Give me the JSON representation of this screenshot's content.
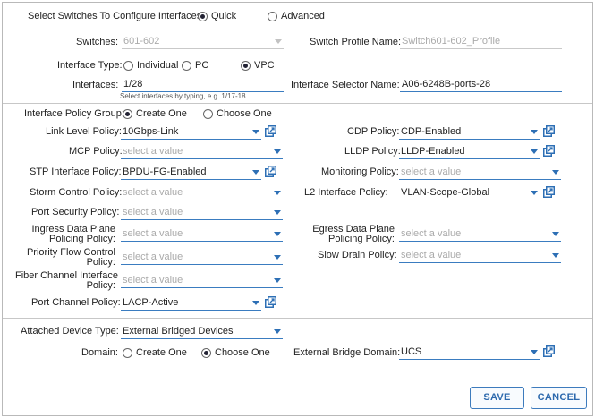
{
  "select_switches": {
    "label": "Select Switches To Configure Interfaces:",
    "options": [
      "Quick",
      "Advanced"
    ],
    "selected": "Quick"
  },
  "switches": {
    "label": "Switches:",
    "value": "601-602"
  },
  "switch_profile": {
    "label": "Switch Profile Name:",
    "value": "Switch601-602_Profile"
  },
  "interface_type": {
    "label": "Interface Type:",
    "options": [
      "Individual",
      "PC",
      "VPC"
    ],
    "selected": "VPC"
  },
  "interfaces": {
    "label": "Interfaces:",
    "value": "1/28",
    "hint": "Select interfaces by typing, e.g. 1/17-18."
  },
  "interface_selector": {
    "label": "Interface Selector Name:",
    "value": "A06-6248B-ports-28"
  },
  "policy_group": {
    "label": "Interface Policy Group:",
    "options": [
      "Create One",
      "Choose One"
    ],
    "selected": "Create One"
  },
  "placeholder": "select a value",
  "left_policies": {
    "link_level": {
      "label": "Link Level Policy:",
      "value": "10Gbps-Link"
    },
    "mcp": {
      "label": "MCP Policy:",
      "value": ""
    },
    "stp": {
      "label": "STP Interface Policy:",
      "value": "BPDU-FG-Enabled"
    },
    "storm": {
      "label": "Storm Control Policy:",
      "value": ""
    },
    "port_security": {
      "label": "Port Security Policy:",
      "value": ""
    },
    "ingress": {
      "label_1": "Ingress Data Plane",
      "label_2": "Policing Policy:",
      "value": ""
    },
    "pfc": {
      "label_1": "Priority Flow Control",
      "label_2": "Policy:",
      "value": ""
    },
    "fiber": {
      "label_1": "Fiber Channel Interface",
      "label_2": "Policy:",
      "value": ""
    },
    "port_channel": {
      "label": "Port Channel Policy:",
      "value": "LACP-Active"
    }
  },
  "right_policies": {
    "cdp": {
      "label": "CDP Policy:",
      "value": "CDP-Enabled"
    },
    "lldp": {
      "label": "LLDP Policy:",
      "value": "LLDP-Enabled"
    },
    "monitoring": {
      "label": "Monitoring Policy:",
      "value": ""
    },
    "l2": {
      "label": "L2 Interface Policy:",
      "value": "VLAN-Scope-Global"
    },
    "egress": {
      "label_1": "Egress Data Plane",
      "label_2": "Policing Policy:",
      "value": ""
    },
    "slow_drain": {
      "label": "Slow Drain Policy:",
      "value": ""
    }
  },
  "attached_device": {
    "label": "Attached Device Type:",
    "value": "External Bridged Devices"
  },
  "domain": {
    "label": "Domain:",
    "options": [
      "Create One",
      "Choose One"
    ],
    "selected": "Choose One"
  },
  "external_bridge_domain": {
    "label": "External Bridge Domain:",
    "value": "UCS"
  },
  "buttons": {
    "save": "SAVE",
    "cancel": "CANCEL"
  },
  "colors": {
    "accent": "#2d6fb5",
    "underline": "#3a7cc0",
    "placeholder": "#aaaaaa"
  }
}
